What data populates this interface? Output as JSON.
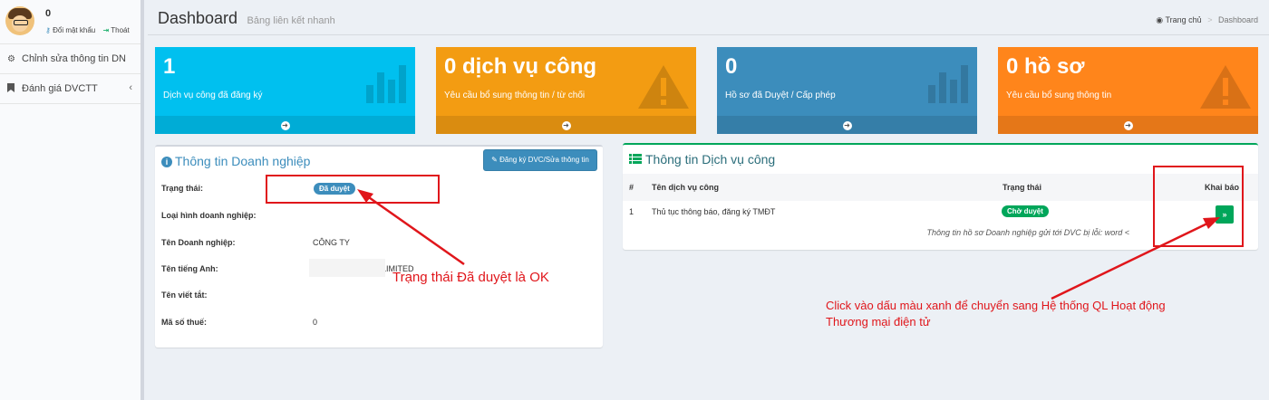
{
  "user": {
    "name": "0",
    "change_password": "Đổi mật khẩu",
    "logout": "Thoát"
  },
  "sidebar": {
    "items": [
      {
        "label": "Chỉnh sửa thông tin DN",
        "icon": "gear-icon"
      },
      {
        "label": "Đánh giá DVCTT",
        "icon": "bookmark-icon"
      }
    ]
  },
  "header": {
    "title": "Dashboard",
    "subtitle": "Bảng liên kết nhanh"
  },
  "breadcrumb": {
    "home": "Trang chủ",
    "current": "Dashboard"
  },
  "stat_boxes": [
    {
      "number": "1",
      "text": "Dịch vụ công đã đăng ký",
      "color": "#00c0ef",
      "icon": "bar-chart-icon"
    },
    {
      "number": "0 dịch vụ công",
      "text": "Yêu cầu bổ sung thông tin / từ chối",
      "color": "#f39c12",
      "icon": "warning-icon"
    },
    {
      "number": "0",
      "text": "Hồ sơ đã Duyệt / Cấp phép",
      "color": "#3c8dbc",
      "icon": "bar-chart-icon"
    },
    {
      "number": "0 hồ sơ",
      "text": "Yêu cầu bổ sung thông tin",
      "color": "#ff851b",
      "icon": "warning-icon"
    }
  ],
  "company": {
    "title": "Thông tin Doanh nghiệp",
    "edit_button": "Đăng ký DVC/Sửa thông tin",
    "status_label": "Trạng thái:",
    "status_value": "Đã duyệt",
    "type_label": "Loại hình doanh nghiệp:",
    "name_label": "Tên Doanh nghiệp:",
    "name_value": "CÔNG TY",
    "en_label": "Tên tiếng Anh:",
    "en_value": "LIMITED",
    "short_label": "Tên viết tắt:",
    "tax_label": "Mã số thuế:",
    "tax_value": "0"
  },
  "services": {
    "title": "Thông tin Dịch vụ công",
    "columns": [
      "#",
      "Tên dịch vụ công",
      "Trạng thái",
      "Khai báo"
    ],
    "rows": [
      {
        "index": "1",
        "name": "Thủ tục thông báo, đăng ký TMĐT",
        "status": "Chờ duyệt",
        "action": "»"
      }
    ],
    "note": "Thông tin hồ sơ Doanh nghiệp gửi tới DVC bị lỗi: word <"
  },
  "annotations": {
    "status_ok": "Trạng thái Đã duyệt là OK",
    "click_green_line1": "Click vào dấu màu xanh để chuyển sang Hệ thống QL Hoạt động",
    "click_green_line2": "Thương mại điện tử"
  }
}
